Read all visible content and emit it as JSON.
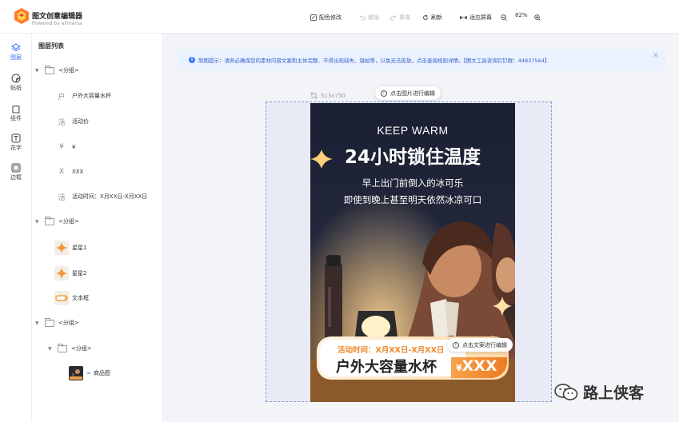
{
  "app": {
    "title": "图文创意编辑器",
    "subtitle": "Powered by alimama"
  },
  "toolbar": {
    "color_edit": "配色修改",
    "undo": "撤销",
    "redo": "重做",
    "refresh": "刷新",
    "fit_screen": "适应屏幕",
    "zoom_level": "82%",
    "icons": [
      "palette-icon",
      "undo-icon",
      "redo-icon",
      "refresh-icon",
      "fit-icon",
      "zoom-out-icon",
      "zoom-in-icon"
    ]
  },
  "rail": [
    {
      "label": "图层",
      "icon": "layers-icon"
    },
    {
      "label": "贴纸",
      "icon": "sticker-icon"
    },
    {
      "label": "组件",
      "icon": "puzzle-icon"
    },
    {
      "label": "花字",
      "icon": "text-effect-icon"
    },
    {
      "label": "边框",
      "icon": "frame-icon"
    }
  ],
  "layers": {
    "title": "图层列表",
    "group_label": "<分组>",
    "items": [
      {
        "label": "户外大容量水杯",
        "glyph": "户"
      },
      {
        "label": "活动价",
        "glyph": "活"
      },
      {
        "label": "¥",
        "glyph": "¥"
      },
      {
        "label": "XXX",
        "glyph": "X"
      },
      {
        "label": "活动时间：X月XX日-X月XX日",
        "glyph": "活"
      },
      {
        "label": "星星1"
      },
      {
        "label": "星星2"
      },
      {
        "label": "文本框"
      },
      {
        "label": "商品图"
      }
    ]
  },
  "notice": {
    "text": "制图提示：请务必确保您的素材内容文案和主体完整、不得出现缺失、错拍等，以免无法投放。点击查阅规则详情。【图文工具咨询钉钉群：44837564】"
  },
  "canvas": {
    "size_label": "513x750",
    "edit_image_hint": "点击图片进行编辑",
    "edit_text_hint": "点击文案进行编辑"
  },
  "poster": {
    "eyebrow": "KEEP WARM",
    "headline": "24小时锁住温度",
    "line1": "早上出门前倒入的冰可乐",
    "line2": "即使到晚上甚至明天依然冰凉可口",
    "event_time": "活动时间：X月XX日-X月XX日",
    "product_name": "户外大容量水杯",
    "currency": "¥",
    "price": "XXX"
  },
  "watermark": {
    "text": "路上侠客"
  },
  "colors": {
    "accent": "#2f6bff",
    "poster_dark": "#1c2030",
    "orange": "#f08a2c"
  }
}
